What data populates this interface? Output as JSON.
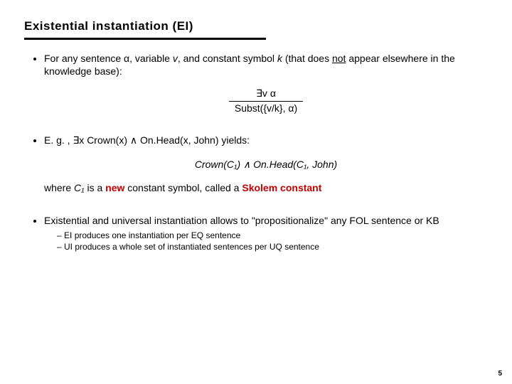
{
  "title": "Existential instantiation (EI)",
  "b1": {
    "pre": "For any sentence α, variable ",
    "v": "v",
    "mid1": ", and constant symbol ",
    "k": "k",
    "mid2": " (that does ",
    "not": "not",
    "post": " appear elsewhere in the knowledge base):"
  },
  "rule": {
    "top": "∃v α",
    "bot": "Subst({v/k}, α)"
  },
  "b2": {
    "line": "E. g. , ∃x Crown(x) ∧ On.Head(x, John) yields:",
    "concl": "Crown(C₁) ∧ On.Head(C₁, John)",
    "where_pre": "where ",
    "where_c1": "C₁",
    "where_mid": " is a ",
    "where_new": "new",
    "where_post1": " constant symbol, called a ",
    "where_sk": "Skolem constant"
  },
  "b3": {
    "line": "Existential and universal instantiation allows to \"propositionalize\" any FOL sentence or KB",
    "s1": "EI produces one instantiation per EQ sentence",
    "s2": "UI produces a whole set of instantiated sentences per UQ sentence"
  },
  "page": "5"
}
